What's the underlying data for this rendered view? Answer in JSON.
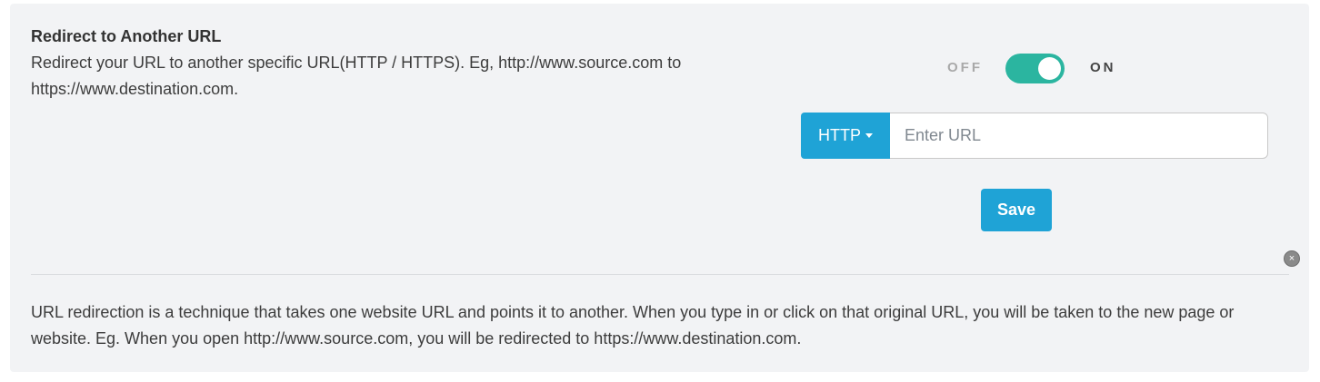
{
  "section": {
    "title": "Redirect to Another URL",
    "description": "Redirect your URL to another specific URL(HTTP / HTTPS). Eg, http://www.source.com to https://www.destination.com."
  },
  "toggle": {
    "off_label": "OFF",
    "on_label": "ON",
    "state": "on",
    "color": "#2bb5a0"
  },
  "url_form": {
    "protocol": "HTTP",
    "input_value": "",
    "input_placeholder": "Enter URL",
    "save_label": "Save",
    "accent_color": "#1fa3d6"
  },
  "close": {
    "icon": "close-icon",
    "glyph": "×"
  },
  "info": {
    "text": "URL redirection is a technique that takes one website URL and points it to another. When you type in or click on that original URL, you will be taken to the new page or website. Eg. When you open http://www.source.com, you will be redirected to https://www.destination.com."
  }
}
